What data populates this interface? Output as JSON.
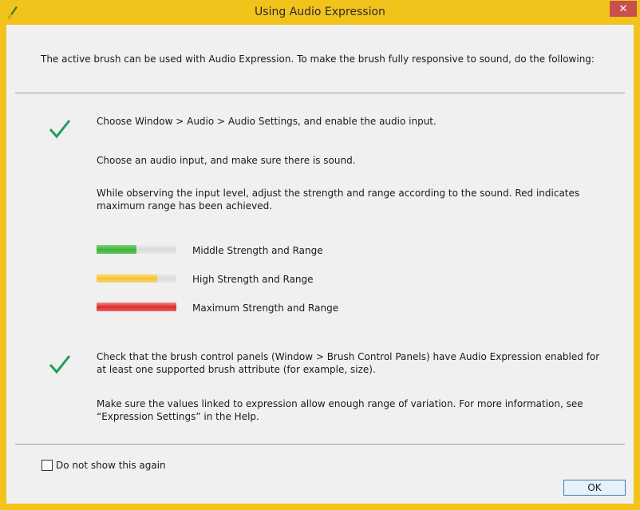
{
  "window": {
    "title": "Using Audio Expression",
    "close_label": "✕"
  },
  "intro": "The active brush can be used with Audio Expression. To make the brush fully responsive to sound, do the following:",
  "steps": {
    "step1": "Choose Window > Audio > Audio Settings, and enable the audio input.",
    "step2": "Choose an audio input, and make sure there is sound.",
    "step3": "While observing the input level, adjust the strength and range according to the sound. Red indicates maximum range has been achieved.",
    "step4": "Check that the brush control panels (Window > Brush Control Panels) have Audio Expression enabled for at least one supported brush attribute (for example, size).",
    "step5": "Make sure the values linked to expression allow enough range of variation. For more information, see “Expression Settings” in the Help."
  },
  "levels": [
    {
      "label": "Middle Strength and Range",
      "fill": 0.5,
      "color": "#3fb33a"
    },
    {
      "label": "High Strength and Range",
      "fill": 0.76,
      "color": "#f2c23a"
    },
    {
      "label": "Maximum Strength and Range",
      "fill": 1.0,
      "color": "#dc2b2b"
    }
  ],
  "footer": {
    "checkbox_label": "Do not show this again",
    "checkbox_checked": false,
    "ok_label": "OK"
  },
  "colors": {
    "frame": "#f1c31b",
    "check": "#1e9e5a",
    "close": "#c7504a"
  },
  "icons": {
    "app": "paintbrush-icon",
    "check": "check-icon",
    "close": "close-icon"
  }
}
